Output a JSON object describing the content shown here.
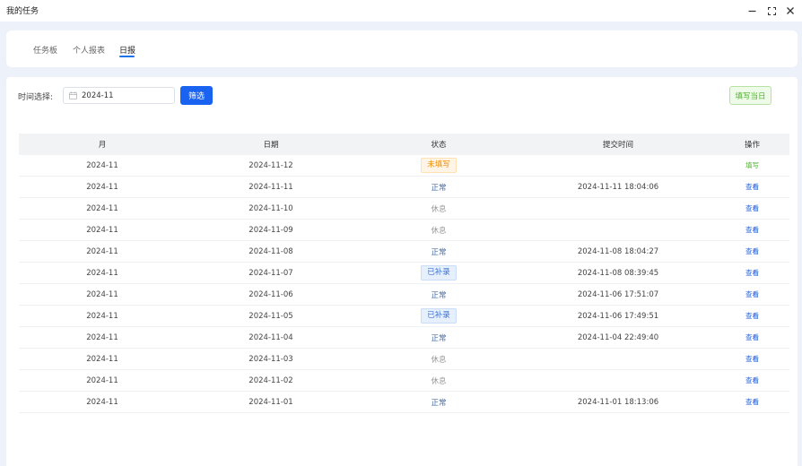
{
  "window": {
    "title": "我的任务"
  },
  "tabs": [
    {
      "label": "任务板",
      "active": false
    },
    {
      "label": "个人报表",
      "active": false
    },
    {
      "label": "日报",
      "active": true
    }
  ],
  "filter": {
    "label": "时间选择:",
    "date_value": "2024-11",
    "filter_button": "筛选",
    "fill_today_button": "填写当日"
  },
  "table": {
    "headers": [
      "月",
      "日期",
      "状态",
      "提交时间",
      "操作"
    ],
    "rows": [
      {
        "month": "2024-11",
        "date": "2024-11-12",
        "status": "未填写",
        "submitted": "",
        "action": "填写"
      },
      {
        "month": "2024-11",
        "date": "2024-11-11",
        "status": "正常",
        "submitted": "2024-11-11 18:04:06",
        "action": "查看"
      },
      {
        "month": "2024-11",
        "date": "2024-11-10",
        "status": "休息",
        "submitted": "",
        "action": "查看"
      },
      {
        "month": "2024-11",
        "date": "2024-11-09",
        "status": "休息",
        "submitted": "",
        "action": "查看"
      },
      {
        "month": "2024-11",
        "date": "2024-11-08",
        "status": "正常",
        "submitted": "2024-11-08 18:04:27",
        "action": "查看"
      },
      {
        "month": "2024-11",
        "date": "2024-11-07",
        "status": "已补录",
        "submitted": "2024-11-08 08:39:45",
        "action": "查看"
      },
      {
        "month": "2024-11",
        "date": "2024-11-06",
        "status": "正常",
        "submitted": "2024-11-06 17:51:07",
        "action": "查看"
      },
      {
        "month": "2024-11",
        "date": "2024-11-05",
        "status": "已补录",
        "submitted": "2024-11-06 17:49:51",
        "action": "查看"
      },
      {
        "month": "2024-11",
        "date": "2024-11-04",
        "status": "正常",
        "submitted": "2024-11-04 22:49:40",
        "action": "查看"
      },
      {
        "month": "2024-11",
        "date": "2024-11-03",
        "status": "休息",
        "submitted": "",
        "action": "查看"
      },
      {
        "month": "2024-11",
        "date": "2024-11-02",
        "status": "休息",
        "submitted": "",
        "action": "查看"
      },
      {
        "month": "2024-11",
        "date": "2024-11-01",
        "status": "正常",
        "submitted": "2024-11-01 18:13:06",
        "action": "查看"
      }
    ]
  },
  "colors": {
    "primary": "#1a63f0",
    "success": "#52b132",
    "warning": "#f08c00",
    "background": "#edf1f9"
  }
}
